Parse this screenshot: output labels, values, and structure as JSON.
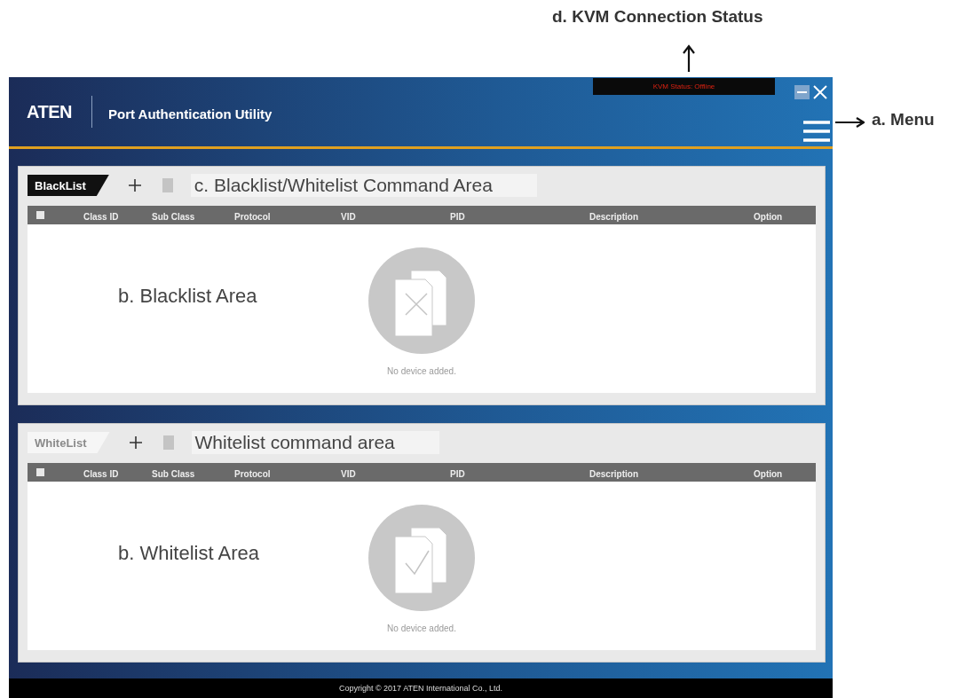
{
  "annotations": {
    "kvm_status": "d. KVM Connection Status",
    "menu": "a. Menu"
  },
  "window": {
    "logo": "ATEN",
    "title": "Port Authentication Utility",
    "kvm_status": "KVM Status: Offline"
  },
  "lists": [
    {
      "tab": "BlackList",
      "selected": true,
      "all_checked": false,
      "kind": "blacklist",
      "command_note": "c. Blacklist/Whitelist Command Area",
      "area_note": "b. Blacklist Area",
      "columns": [
        "Class ID",
        "Sub Class",
        "Protocol",
        "VID",
        "PID",
        "Description",
        "Option"
      ],
      "empty_text": "No device added."
    },
    {
      "tab": "WhiteList",
      "selected": false,
      "all_checked": false,
      "kind": "whitelist",
      "command_note": "Whitelist command area",
      "area_note": "b. Whitelist Area",
      "columns": [
        "Class ID",
        "Sub Class",
        "Protocol",
        "VID",
        "PID",
        "Description",
        "Option"
      ],
      "empty_text": "No device added."
    }
  ],
  "footer": "Copyright © 2017 ATEN International Co., Ltd."
}
